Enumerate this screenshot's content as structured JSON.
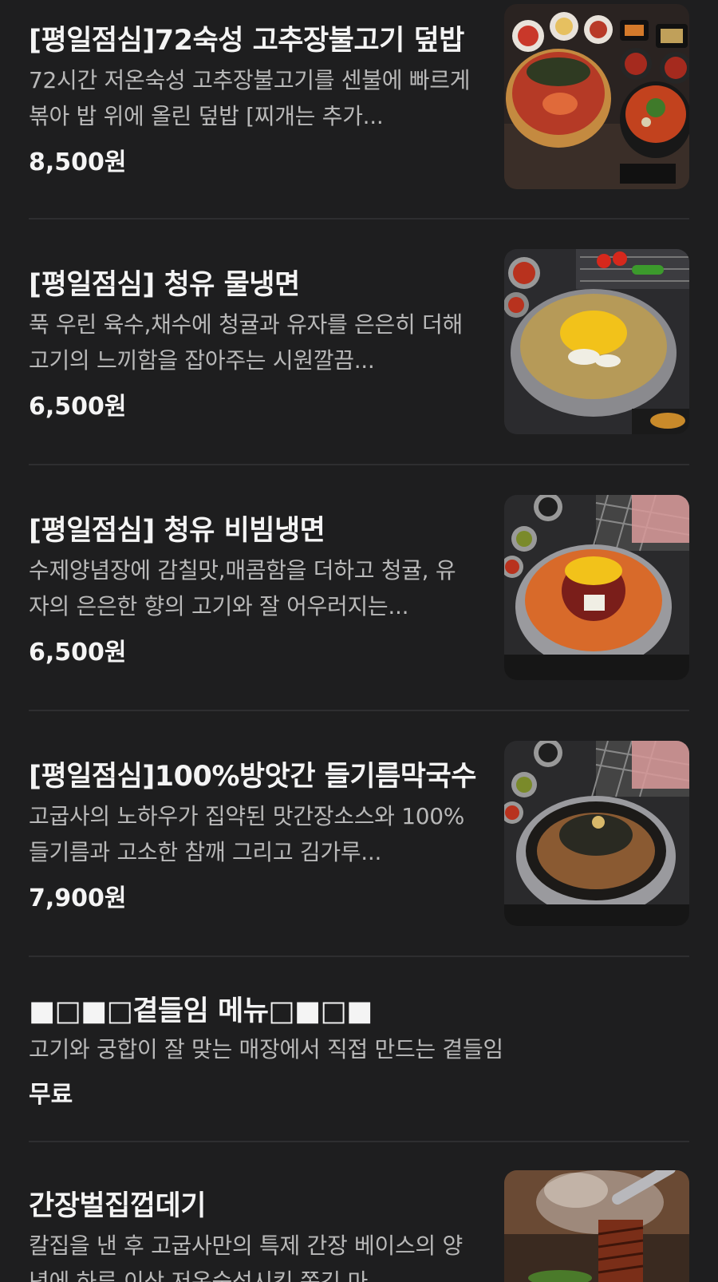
{
  "menu": {
    "items": [
      {
        "title": "[평일점심]72숙성 고추장불고기 덮밥",
        "description": "72시간 저온숙성 고추장불고기를 센불에 빠르게 볶아 밥 위에 올린 덮밥 [찌개는 추가...",
        "price": "8,500원",
        "image": "bulgogi-rice-bowl-photo"
      },
      {
        "title": "[평일점심] 청유 물냉면",
        "description": "푹 우린 육수,채수에 청귤과 유자를 은은히 더해 고기의 느끼함을 잡아주는 시원깔끔...",
        "price": "6,500원",
        "image": "cold-noodle-soup-photo"
      },
      {
        "title": "[평일점심] 청유 비빔냉면",
        "description": "수제양념장에 감칠맛,매콤함을 더하고 청귤, 유자의 은은한 향의 고기와 잘 어우러지는...",
        "price": "6,500원",
        "image": "spicy-cold-noodle-photo"
      },
      {
        "title": "[평일점심]100%방앗간 들기름막국수",
        "description": "고굽사의 노하우가 집약된 맛간장소스와 100% 들기름과 고소한 참깨 그리고 김가루...",
        "price": "7,900원",
        "image": "perilla-oil-noodle-photo"
      },
      {
        "title": "■□■□곁들임 메뉴□■□■",
        "description": "고기와 궁합이 잘 맞는 매장에서 직접 만드는 곁들임",
        "price": "무료",
        "image": ""
      },
      {
        "title": "간장벌집껍데기",
        "description": "칼집을 낸 후 고굽사만의 특제 간장 베이스의 양념에 하루 이상 저온숙성시킨 쫀깃 마",
        "price": "",
        "image": "soy-pork-skin-photo"
      }
    ]
  },
  "colors": {
    "background": "#1e1e1f",
    "title": "#f4f4f4",
    "description": "#b9b9b9",
    "divider": "#2e2e30"
  }
}
